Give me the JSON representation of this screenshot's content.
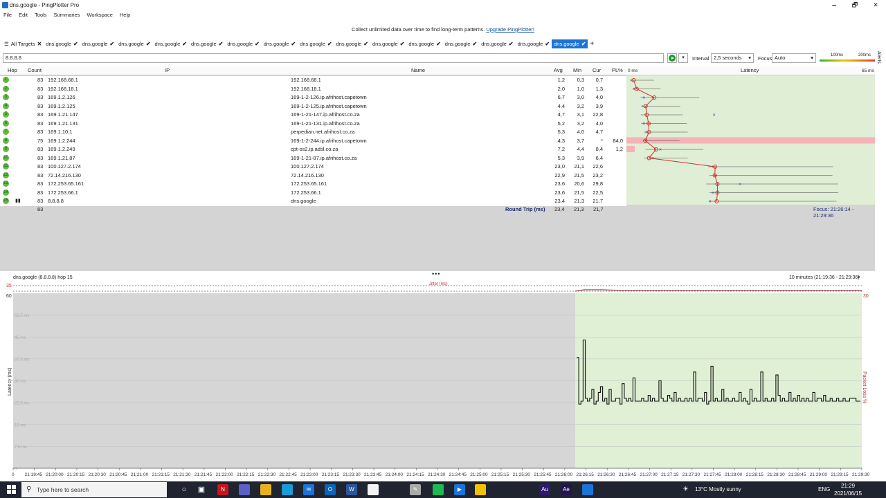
{
  "window": {
    "title": "dns.google - PingPlotter Pro",
    "minimize": "🗕",
    "maximize": "🗗",
    "close": "✕"
  },
  "menu": [
    "File",
    "Edit",
    "Tools",
    "Summaries",
    "Workspace",
    "Help"
  ],
  "promo": {
    "text": "Collect unlimited data over time to find long-term patterns.",
    "link": "Upgrade PingPlotter!"
  },
  "tabs": {
    "all_targets": "All Targets",
    "items": [
      "dns.google",
      "dns.google",
      "dns.google",
      "dns.google",
      "dns.google",
      "dns.google",
      "dns.google",
      "dns.google",
      "dns.google",
      "dns.google",
      "dns.google",
      "dns.google",
      "dns.google",
      "dns.google",
      "dns.google"
    ],
    "active_index": 14,
    "add": "+"
  },
  "toolbar": {
    "target": "8.8.8.8",
    "interval_label": "Interval",
    "interval_value": "2,5 seconds",
    "focus_label": "Focus",
    "focus_value": "Auto",
    "scale_100": "100ms",
    "scale_200": "200ms",
    "alerts": "Alerts"
  },
  "grid": {
    "headers": {
      "hop": "Hop",
      "count": "Count",
      "ip": "IP",
      "name": "Name",
      "avg": "Avg",
      "min": "Min",
      "cur": "Cur",
      "pl": "PL%",
      "zero": "0 ms",
      "latency": "Latency",
      "max": "65 ms"
    },
    "rows": [
      {
        "hop": "1",
        "count": "83",
        "ip": "192.168.68.1",
        "name": "192.168.68.1",
        "avg": "1,2",
        "min": "0,3",
        "cur": "0,7",
        "pl": ""
      },
      {
        "hop": "2",
        "count": "83",
        "ip": "192.168.18.1",
        "name": "192.168.18.1",
        "avg": "2,0",
        "min": "1,0",
        "cur": "1,3",
        "pl": ""
      },
      {
        "hop": "3",
        "count": "83",
        "ip": "169.1.2.126",
        "name": "169-1-2-126.ip.afrihost.capetown",
        "avg": "6,7",
        "min": "3,0",
        "cur": "4,0",
        "pl": ""
      },
      {
        "hop": "4",
        "count": "83",
        "ip": "169.1.2.125",
        "name": "169-1-2-125.ip.afrihost.capetown",
        "avg": "4,4",
        "min": "3,2",
        "cur": "3,9",
        "pl": ""
      },
      {
        "hop": "5",
        "count": "83",
        "ip": "169.1.21.147",
        "name": "169-1-21-147.ip.afrihost.co.za",
        "avg": "4,7",
        "min": "3,1",
        "cur": "22,8",
        "pl": ""
      },
      {
        "hop": "6",
        "count": "83",
        "ip": "169.1.21.131",
        "name": "169-1-21-131.ip.afrihost.co.za",
        "avg": "5,2",
        "min": "3,2",
        "cur": "4,0",
        "pl": ""
      },
      {
        "hop": "7",
        "count": "83",
        "ip": "169.1.10.1",
        "name": "perpedian.net.afrihost.co.za",
        "avg": "5,3",
        "min": "4,0",
        "cur": "4,7",
        "pl": ""
      },
      {
        "hop": "8",
        "count": "75",
        "ip": "169.1.2.244",
        "name": "169-1-2-244.ip.afrihost.capetown",
        "avg": "4,3",
        "min": "3,7",
        "cur": "*",
        "pl": "84,0"
      },
      {
        "hop": "9",
        "count": "83",
        "ip": "169.1.2.249",
        "name": "cpt-os2.ip.adsl.co.za",
        "avg": "7,2",
        "min": "4,4",
        "cur": "8,4",
        "pl": "1,2"
      },
      {
        "hop": "10",
        "count": "83",
        "ip": "169.1.21.87",
        "name": "169-1-21-87.ip.afrihost.co.za",
        "avg": "5,3",
        "min": "3,9",
        "cur": "6,4",
        "pl": ""
      },
      {
        "hop": "11",
        "count": "83",
        "ip": "100.127.2.174",
        "name": "100.127.2.174",
        "avg": "23,0",
        "min": "21,1",
        "cur": "22,6",
        "pl": ""
      },
      {
        "hop": "12",
        "count": "83",
        "ip": "72.14.216.130",
        "name": "72.14.216.130",
        "avg": "22,9",
        "min": "21,5",
        "cur": "23,2",
        "pl": ""
      },
      {
        "hop": "13",
        "count": "83",
        "ip": "172.253.65.161",
        "name": "172.253.65.161",
        "avg": "23,6",
        "min": "20,6",
        "cur": "29,8",
        "pl": ""
      },
      {
        "hop": "14",
        "count": "83",
        "ip": "172.253.66.1",
        "name": "172.253.66.1",
        "avg": "23,6",
        "min": "21,5",
        "cur": "22,5",
        "pl": ""
      },
      {
        "hop": "15",
        "count": "83",
        "ip": "8.8.8.8",
        "name": "dns.google",
        "avg": "23,4",
        "min": "21,3",
        "cur": "21,7",
        "pl": ""
      }
    ],
    "summary": {
      "count": "83",
      "label": "Round Trip (ms)",
      "avg": "23,4",
      "min": "21,3",
      "cur": "21,7",
      "focus": "Focus: 21:26:14 - 21:29:36"
    }
  },
  "timeline": {
    "title": "dns.google (8.8.8.8) hop 15",
    "range": "10 minutes (21:19:36 - 21:29:36)",
    "jitter_label": "Jitter (ms)",
    "jitter_max": "35",
    "y_max_left": "60",
    "y_max_right": "30",
    "y_label": "Latency (ms)",
    "right_label": "Packet Loss %",
    "y_ticks": [
      "52,5 ms",
      "45 ms",
      "37,5 ms",
      "30 ms",
      "22,5 ms",
      "15 ms",
      "7,5 ms",
      "0"
    ],
    "x_ticks": [
      "0",
      "21:19:45",
      "21:20:00",
      "21:20:15",
      "21:20:30",
      "21:20:45",
      "21:21:00",
      "21:21:15",
      "21:21:30",
      "21:21:45",
      "21:22:00",
      "21:22:15",
      "21:22:30",
      "21:22:45",
      "21:23:00",
      "21:23:15",
      "21:23:30",
      "21:23:45",
      "21:24:00",
      "21:24:15",
      "21:24:30",
      "21:24:45",
      "21:25:00",
      "21:25:15",
      "21:25:30",
      "21:25:45",
      "21:26:00",
      "21:26:15",
      "21:26:30",
      "21:26:45",
      "21:27:00",
      "21:27:15",
      "21:27:30",
      "21:27:45",
      "21:28:00",
      "21:28:15",
      "21:28:30",
      "21:28:45",
      "21:29:00",
      "21:29:15",
      "21:29:30"
    ]
  },
  "taskbar": {
    "search": "Type here to search",
    "weather": "13°C  Mostly sunny",
    "lang": "ENG",
    "time": "21:29",
    "date": "2021/06/15"
  },
  "chart_data": {
    "type": "line",
    "title": "dns.google (8.8.8.8) hop 15",
    "ylabel": "Latency (ms)",
    "ylim": [
      0,
      60
    ],
    "x_start": "21:26:14",
    "x_end": "21:29:36",
    "series": [
      {
        "values": [
          38,
          22,
          23,
          44,
          24,
          23,
          24,
          27,
          22,
          23,
          26,
          28,
          23,
          24,
          22,
          27,
          23,
          23,
          24,
          24,
          22,
          29,
          24,
          23,
          24,
          23,
          31,
          23,
          23,
          23,
          24,
          23,
          23,
          25,
          23,
          24,
          23,
          23,
          30,
          24,
          23,
          23,
          25,
          24,
          23,
          26,
          23,
          24,
          23,
          23,
          24,
          23,
          24,
          23,
          33,
          23,
          24,
          24,
          23,
          26,
          22,
          23,
          35,
          23,
          24,
          23,
          23,
          27,
          23,
          24,
          23,
          23,
          24,
          23,
          23,
          26,
          23,
          24,
          23,
          22,
          27,
          23,
          24,
          23,
          23,
          33,
          23,
          24,
          23,
          23,
          24,
          23,
          32,
          25,
          23,
          24,
          23,
          23,
          26,
          23,
          24,
          23,
          25,
          23,
          24,
          23,
          24,
          23,
          23,
          26,
          23,
          24,
          24,
          23,
          25,
          23,
          23,
          24,
          23,
          23,
          24,
          23,
          23,
          24,
          23,
          23,
          24,
          24,
          24,
          23,
          23
        ]
      }
    ]
  }
}
